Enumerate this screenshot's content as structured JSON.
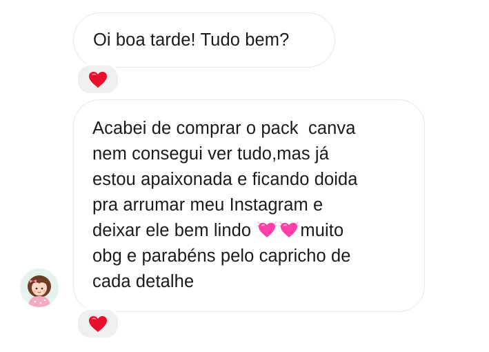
{
  "conversation": {
    "messages": [
      {
        "lines": [
          "Oi boa tarde! Tudo bem?"
        ],
        "reaction": "heart-icon"
      },
      {
        "lines": [
          "Acabei de comprar o pack  canva",
          "nem consegui ver tudo,mas já",
          "estou apaixonada e ficando doida",
          "pra arrumar meu Instagram e",
          "deixar ele bem lindo ",
          "muito",
          "obg e parabéns pelo capricho de",
          "cada detalhe"
        ],
        "emoji": "sparkling-heart-icon",
        "reaction": "heart-icon"
      }
    ],
    "sender_avatar": "avatar-girl-illustration"
  },
  "colors": {
    "bubble_border": "#e9e9e9",
    "reaction_bg": "#efefef",
    "heart": "#e8112d",
    "sparkle_heart": "#ff3fa8"
  }
}
